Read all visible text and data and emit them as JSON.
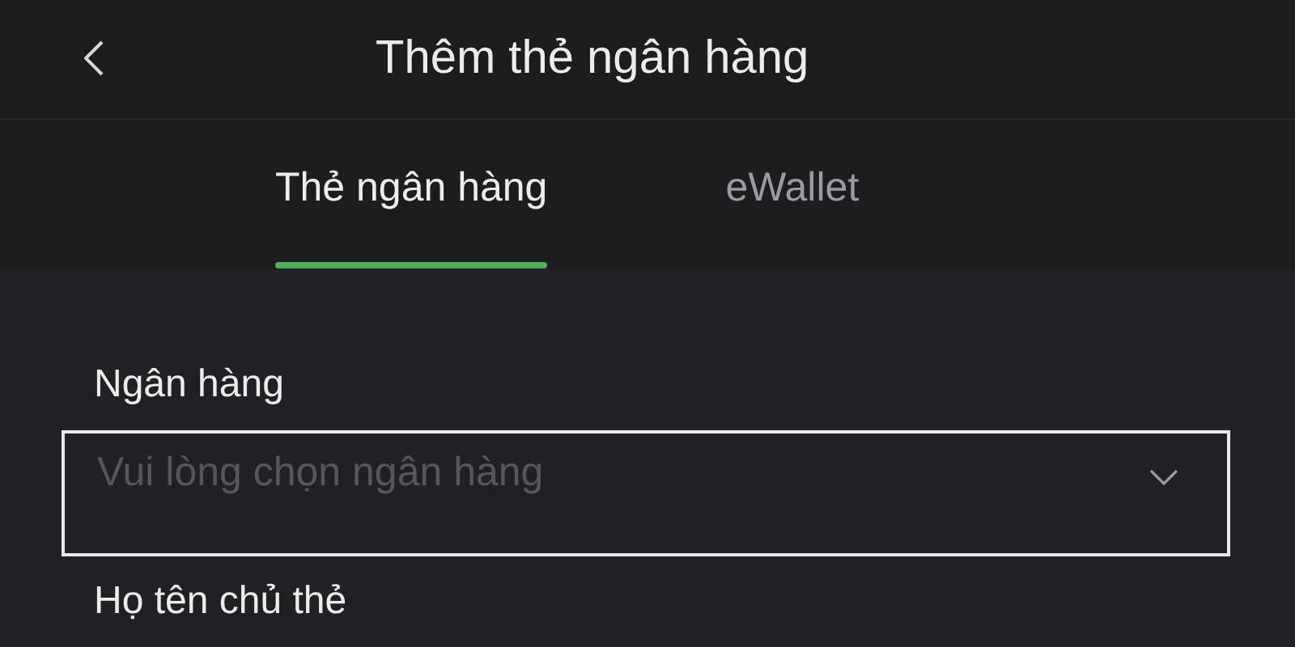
{
  "header": {
    "title": "Thêm thẻ ngân hàng"
  },
  "tabs": [
    {
      "label": "Thẻ ngân hàng",
      "selected": true
    },
    {
      "label": "eWallet",
      "selected": false
    }
  ],
  "form": {
    "fields": [
      {
        "kind": "select",
        "label": "Ngân hàng",
        "placeholder": "Vui lòng chọn ngân hàng"
      },
      {
        "kind": "text",
        "label": "Họ tên chủ thẻ"
      }
    ]
  }
}
